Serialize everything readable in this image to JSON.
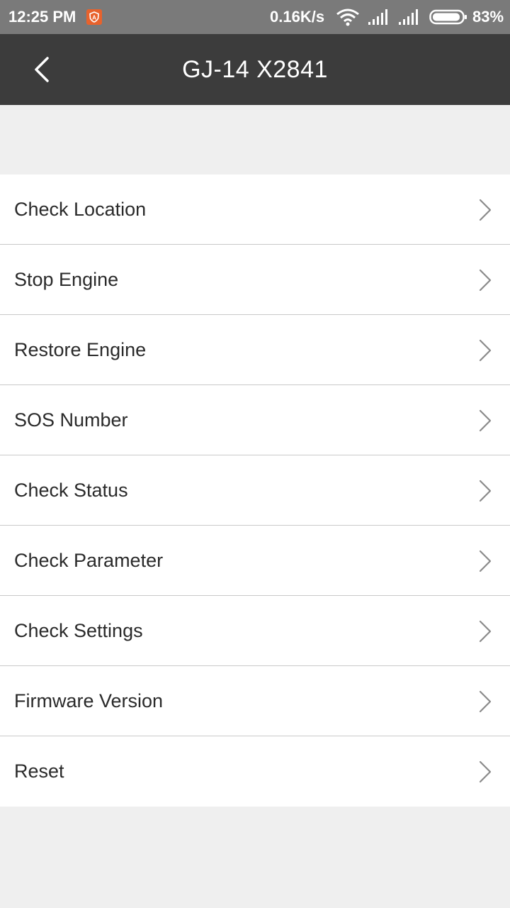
{
  "status_bar": {
    "time": "12:25 PM",
    "app_icon": "shield-app-icon",
    "net_speed": "0.16K/s",
    "wifi_icon": "wifi-icon",
    "signal_icon": "signal-icon",
    "battery_icon": "battery-icon",
    "battery_level": "83%"
  },
  "header": {
    "back_icon": "chevron-left-icon",
    "title": "GJ-14 X2841",
    "background": "#3c3c3c"
  },
  "menu": {
    "chevron_icon": "chevron-right-icon",
    "items": [
      {
        "label": "Check Location"
      },
      {
        "label": "Stop Engine"
      },
      {
        "label": "Restore Engine"
      },
      {
        "label": "SOS Number"
      },
      {
        "label": "Check Status"
      },
      {
        "label": "Check Parameter"
      },
      {
        "label": "Check Settings"
      },
      {
        "label": "Firmware Version"
      },
      {
        "label": "Reset"
      }
    ]
  }
}
